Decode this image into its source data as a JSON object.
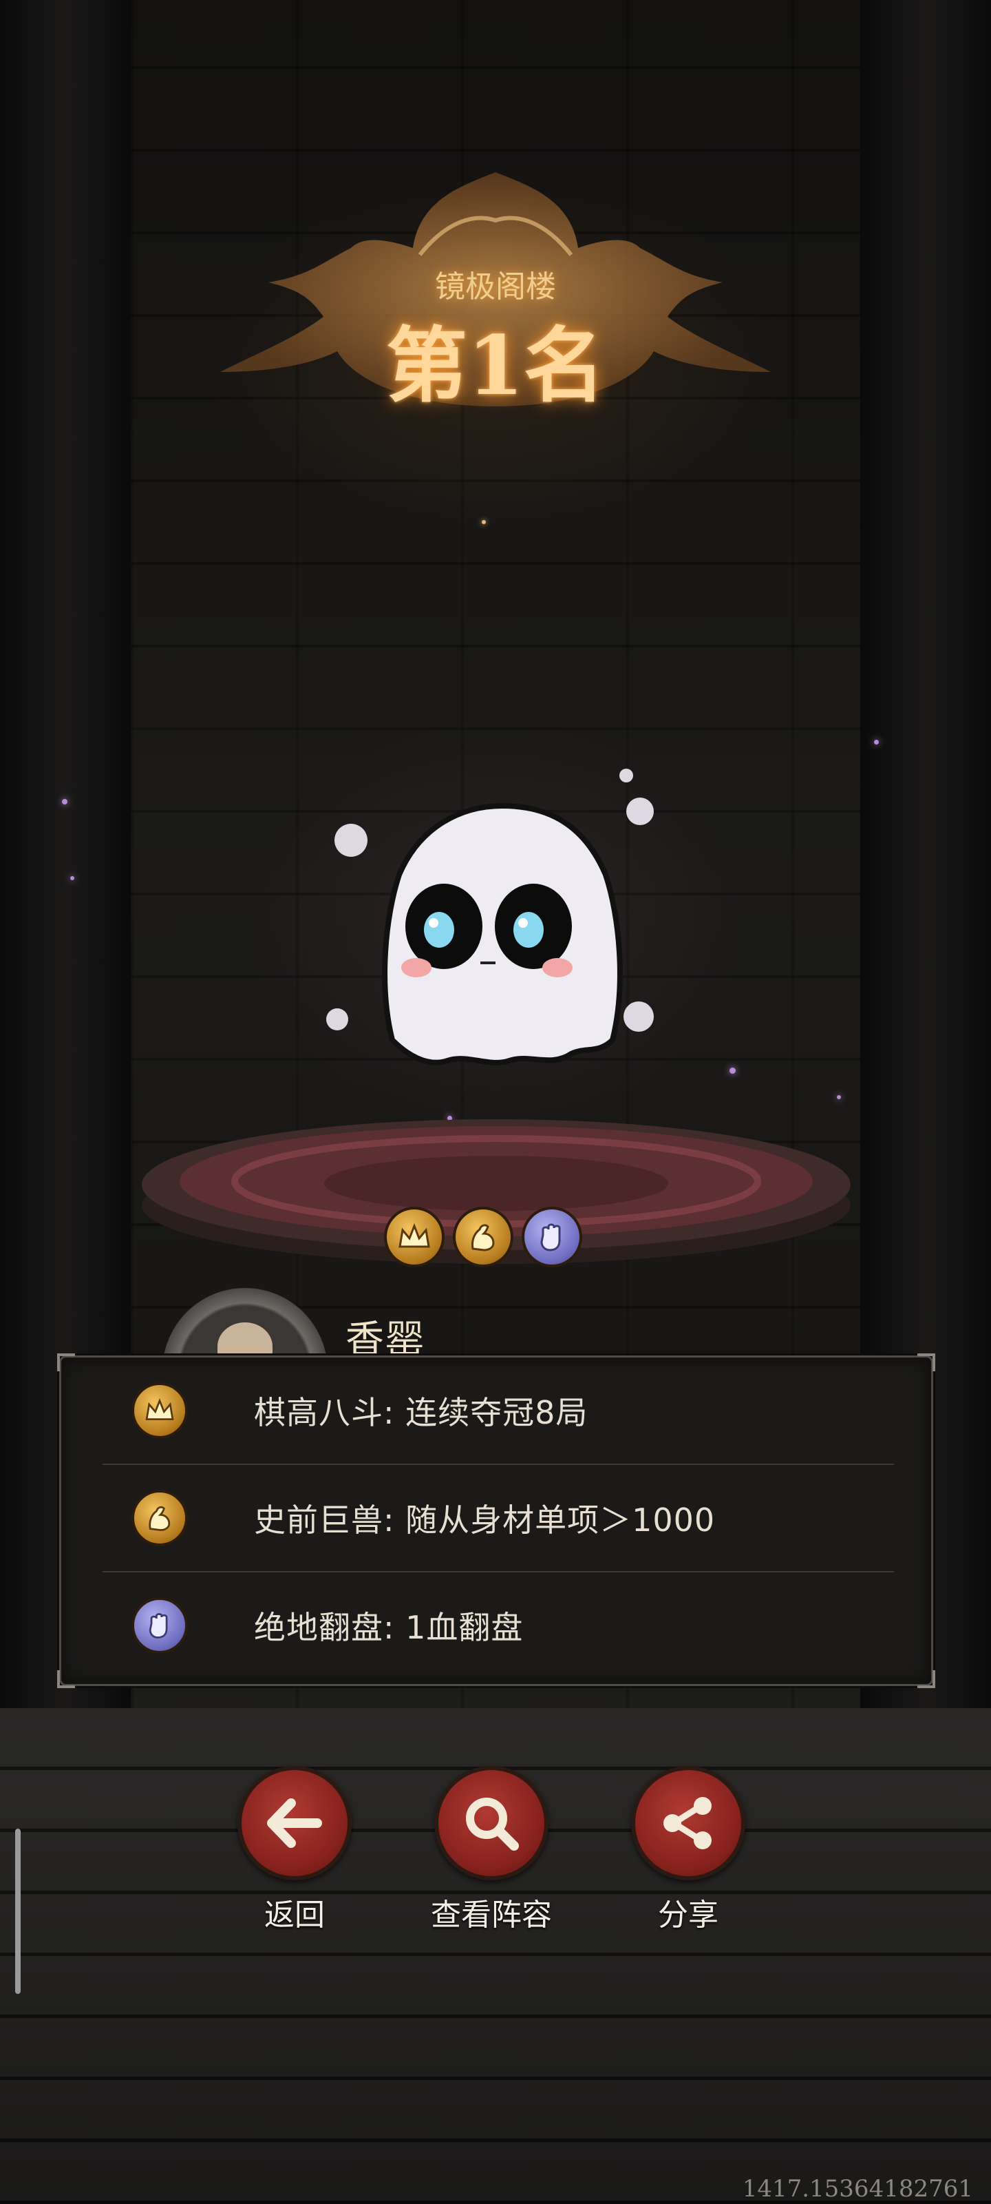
{
  "title": {
    "subtitle": "镜极阁楼",
    "rank": "第1名"
  },
  "player": {
    "name": "香罂"
  },
  "badges": [
    {
      "icon": "crown-icon",
      "color": "#d9a441"
    },
    {
      "icon": "flexed-arm-icon",
      "color": "#d9a441"
    },
    {
      "icon": "fist-icon",
      "color": "#8c8ad8"
    }
  ],
  "achievements": [
    {
      "icon": "crown-icon",
      "text": "棋高八斗: 连续夺冠8局"
    },
    {
      "icon": "flexed-arm-icon",
      "text": "史前巨兽: 随从身材单项＞1000"
    },
    {
      "icon": "fist-icon",
      "text": "绝地翻盘: 1血翻盘"
    }
  ],
  "actions": {
    "back": "返回",
    "view_lineup": "查看阵容",
    "share": "分享"
  },
  "debug_text": "1417.15364182761",
  "colors": {
    "accent_gold": "#ffd79a",
    "button_red": "#9a2a25",
    "panel_bg": "#1b1a19"
  }
}
